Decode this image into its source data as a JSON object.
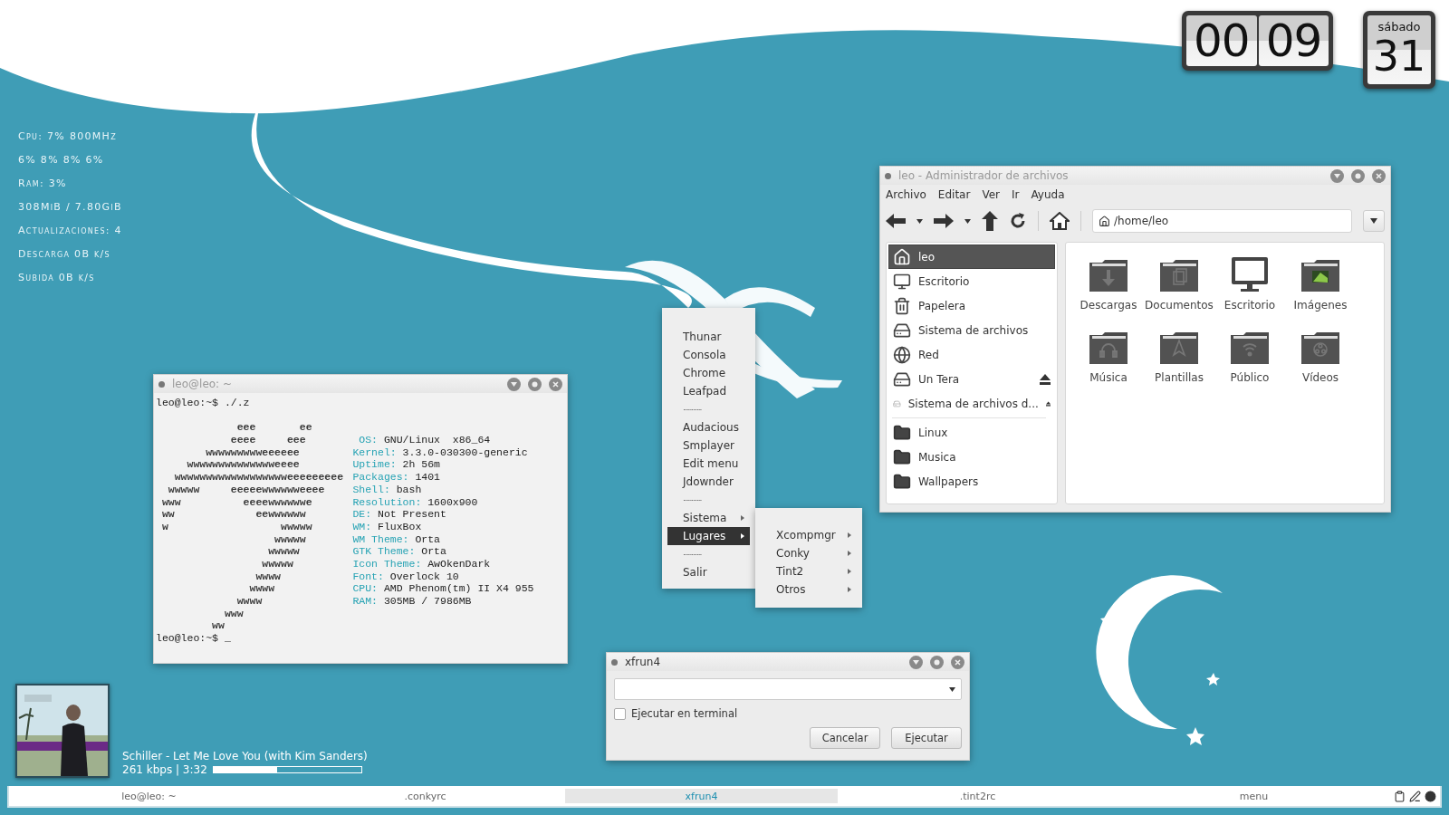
{
  "conky": [
    "Cpu: 7% 800MHz",
    "6% 8% 8% 6%",
    "Ram: 3%",
    "308MiB / 7.80GiB",
    "Actualizaciones: 4",
    "Descarga 0B  k/s",
    "Subida 0B  k/s"
  ],
  "clock": {
    "hours": "00",
    "minutes": "09"
  },
  "calendar": {
    "weekday": "sábado",
    "day": "31"
  },
  "terminal": {
    "title": "leo@leo: ~",
    "command_line": "leo@leo:~$ ./.z",
    "lines": [
      {
        "art": "             eee       ee"
      },
      {
        "art": "            eeee     eee",
        "key": " OS:",
        "value": " GNU/Linux  x86_64"
      },
      {
        "art": "        wwwwwwwwweeeeee",
        "key": "Kernel:",
        "value": " 3.3.0-030300-generic"
      },
      {
        "art": "     wwwwwwwwwwwwwweeee",
        "key": "Uptime:",
        "value": " 2h 56m"
      },
      {
        "art": "   wwwwwwwwwwwwwwwwwweeeeeeeee",
        "key": "Packages:",
        "value": " 1401"
      },
      {
        "art": "  wwwww     eeeeewwwwwweeee",
        "key": "Shell:",
        "value": " bash"
      },
      {
        "art": " www          eeeewwwwwwe",
        "key": "Resolution:",
        "value": " 1600x900"
      },
      {
        "art": " ww             eewwwwww",
        "key": "DE:",
        "value": " Not Present"
      },
      {
        "art": " w                  wwwww",
        "key": "WM:",
        "value": " FluxBox"
      },
      {
        "art": "                   wwwww",
        "key": "WM Theme:",
        "value": " Orta"
      },
      {
        "art": "                  wwwww",
        "key": "GTK Theme:",
        "value": " Orta"
      },
      {
        "art": "                 wwwww",
        "key": "Icon Theme:",
        "value": " AwOkenDark"
      },
      {
        "art": "                wwww",
        "key": "Font:",
        "value": " Overlock 10"
      },
      {
        "art": "               wwww",
        "key": "CPU:",
        "value": " AMD Phenom(tm) II X4 955"
      },
      {
        "art": "             wwww",
        "key": "RAM:",
        "value": " 305MB / 7986MB"
      },
      {
        "art": "           www"
      },
      {
        "art": "         ww"
      }
    ],
    "prompt": "leo@leo:~$",
    "cursor": "_"
  },
  "menu": {
    "items": [
      {
        "kind": "item",
        "label": "Thunar",
        "selected": false
      },
      {
        "kind": "item",
        "label": "Consola",
        "selected": false
      },
      {
        "kind": "item",
        "label": "Chrome",
        "selected": false
      },
      {
        "kind": "item",
        "label": "Leafpad",
        "selected": false
      },
      {
        "kind": "separator",
        "label": "..........."
      },
      {
        "kind": "item",
        "label": "Audacious",
        "selected": false
      },
      {
        "kind": "item",
        "label": "Smplayer",
        "selected": false
      },
      {
        "kind": "item",
        "label": "Edit menu",
        "selected": false
      },
      {
        "kind": "item",
        "label": "Jdownder",
        "selected": false
      },
      {
        "kind": "separator",
        "label": "..........."
      },
      {
        "kind": "submenu",
        "label": "Sistema",
        "selected": false
      },
      {
        "kind": "submenu",
        "label": "Lugares",
        "selected": true
      },
      {
        "kind": "separator",
        "label": "..........."
      },
      {
        "kind": "item",
        "label": "Salir",
        "selected": false
      }
    ],
    "submenu": [
      {
        "kind": "submenu",
        "label": "Xcompmgr",
        "selected": false
      },
      {
        "kind": "submenu",
        "label": "Conky",
        "selected": false
      },
      {
        "kind": "submenu",
        "label": "Tint2",
        "selected": false
      },
      {
        "kind": "submenu",
        "label": "Otros",
        "selected": false
      }
    ]
  },
  "file_manager": {
    "title": "leo - Administrador de archivos",
    "menubar": [
      "Archivo",
      "Editar",
      "Ver",
      "Ir",
      "Ayuda"
    ],
    "location": "/home/leo",
    "places": [
      {
        "label": "leo",
        "kind": "home",
        "selected": true,
        "eject": false
      },
      {
        "label": "Escritorio",
        "kind": "desktop",
        "selected": false,
        "eject": false
      },
      {
        "label": "Papelera",
        "kind": "trash",
        "selected": false,
        "eject": false
      },
      {
        "label": "Sistema de archivos",
        "kind": "drive",
        "selected": false,
        "eject": false
      },
      {
        "label": "Red",
        "kind": "network",
        "selected": false,
        "eject": false
      },
      {
        "label": "Un Tera",
        "kind": "drive",
        "selected": false,
        "eject": true
      },
      {
        "label": "Sistema de archivos d...",
        "kind": "volume",
        "selected": false,
        "eject": true
      }
    ],
    "bookmarks": [
      {
        "label": "Linux",
        "selected": false
      },
      {
        "label": "Musica",
        "selected": false
      },
      {
        "label": "Wallpapers",
        "selected": false
      }
    ],
    "items": [
      {
        "label": "Descargas",
        "kind": "download"
      },
      {
        "label": "Documentos",
        "kind": "documents"
      },
      {
        "label": "Escritorio",
        "kind": "desktop"
      },
      {
        "label": "Imágenes",
        "kind": "pictures"
      },
      {
        "label": "Música",
        "kind": "music"
      },
      {
        "label": "Plantillas",
        "kind": "templates"
      },
      {
        "label": "Público",
        "kind": "public"
      },
      {
        "label": "Vídeos",
        "kind": "videos"
      }
    ]
  },
  "run_dialog": {
    "title": "xfrun4",
    "run_in_terminal": {
      "label": "Ejecutar en terminal",
      "checked": false
    },
    "buttons": [
      "Cancelar",
      "Ejecutar"
    ]
  },
  "player": {
    "track": "Schiller - Let Me Love You (with Kim Sanders)",
    "info": "261 kbps | 3:32",
    "level": 0.43
  },
  "taskbar": {
    "tasks": [
      {
        "label": "leo@leo: ~",
        "selected": false
      },
      {
        "label": ".conkyrc",
        "selected": false
      },
      {
        "label": "xfrun4",
        "selected": true
      },
      {
        "label": ".tint2rc",
        "selected": false
      },
      {
        "label": "menu",
        "selected": false
      }
    ]
  }
}
